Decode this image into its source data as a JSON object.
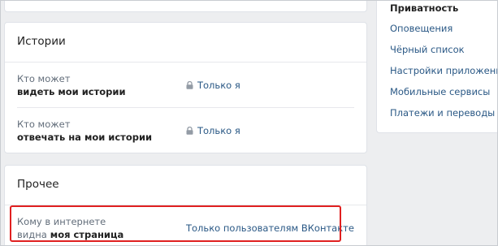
{
  "stories": {
    "title": "Истории",
    "rows": [
      {
        "line1": "Кто может",
        "line2": "видеть мои истории",
        "value": "Только я"
      },
      {
        "line1": "Кто может",
        "line2": "отвечать на мои истории",
        "value": "Только я"
      }
    ]
  },
  "other": {
    "title": "Прочее",
    "row": {
      "line1": "Кому в интернете",
      "line2_plain": "видна",
      "line2_bold": "моя страница",
      "value": "Только пользователям ВКонтакте"
    }
  },
  "menu": {
    "items": [
      {
        "label": "Приватность",
        "active": true
      },
      {
        "label": "Оповещения",
        "active": false
      },
      {
        "label": "Чёрный список",
        "active": false
      },
      {
        "label": "Настройки приложений",
        "active": false
      },
      {
        "label": "Мобильные сервисы",
        "active": false
      },
      {
        "label": "Платежи и переводы",
        "active": false
      }
    ]
  },
  "colors": {
    "link": "#2a5885",
    "highlight": "#e02020",
    "background": "#edeef0"
  },
  "icons": {
    "lock": "lock-icon"
  }
}
